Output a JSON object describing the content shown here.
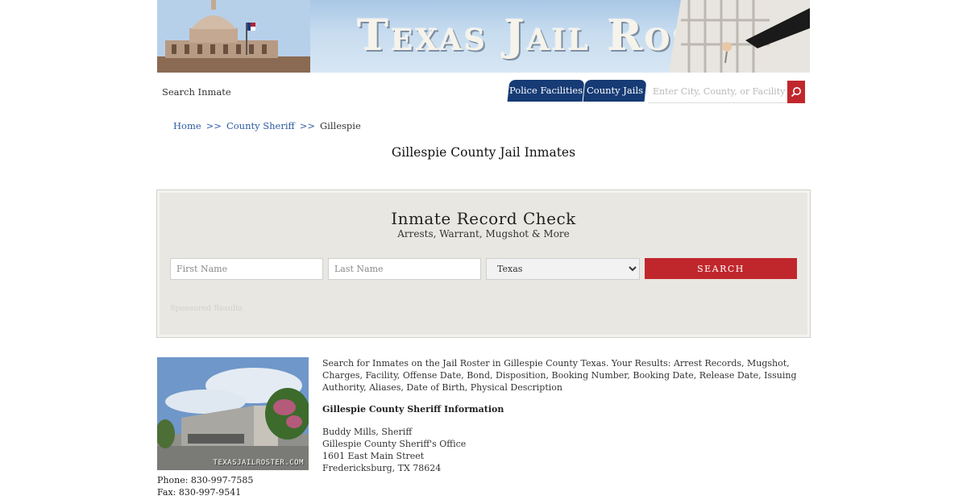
{
  "banner": {
    "title": "Texas Jail Roster"
  },
  "nav": {
    "search_inmate": "Search Inmate",
    "tabs": [
      {
        "label": "Police Facilities"
      },
      {
        "label": "County Jails"
      }
    ],
    "search_placeholder": "Enter City, County, or Facility"
  },
  "breadcrumb": {
    "items": [
      {
        "label": "Home"
      },
      {
        "label": "County Sheriff"
      },
      {
        "label": "Gillespie"
      }
    ],
    "separator": ">>"
  },
  "page_title": "Gillespie County Jail Inmates",
  "record_check": {
    "title": "Inmate Record Check",
    "subtitle": "Arrests, Warrant, Mugshot & More",
    "first_name_placeholder": "First Name",
    "last_name_placeholder": "Last Name",
    "state_selected": "Texas",
    "search_label": "SEARCH",
    "sponsored": "Sponsored Results"
  },
  "info": {
    "description": "Search for Inmates on the Jail Roster in Gillespie County Texas. Your Results: Arrest Records, Mugshot, Charges, Facility, Offense Date, Bond, Disposition, Booking Number, Booking Date, Release Date, Issuing Authority, Aliases, Date of Birth, Physical Description",
    "section_title": "Gillespie County Sheriff Information",
    "address_lines": [
      "Buddy Mills, Sheriff",
      "Gillespie County Sheriff's Office",
      "1601 East Main Street",
      "Fredericksburg, TX 78624"
    ],
    "phone": "Phone: 830-997-7585",
    "fax": "Fax: 830-997-9541",
    "photo_caption": "TEXASJAILROSTER.COM"
  },
  "colors": {
    "nav_blue": "#163b75",
    "accent_red": "#c0272d",
    "link_blue": "#2c5aa0",
    "panel_bg": "#e9e7e2"
  }
}
